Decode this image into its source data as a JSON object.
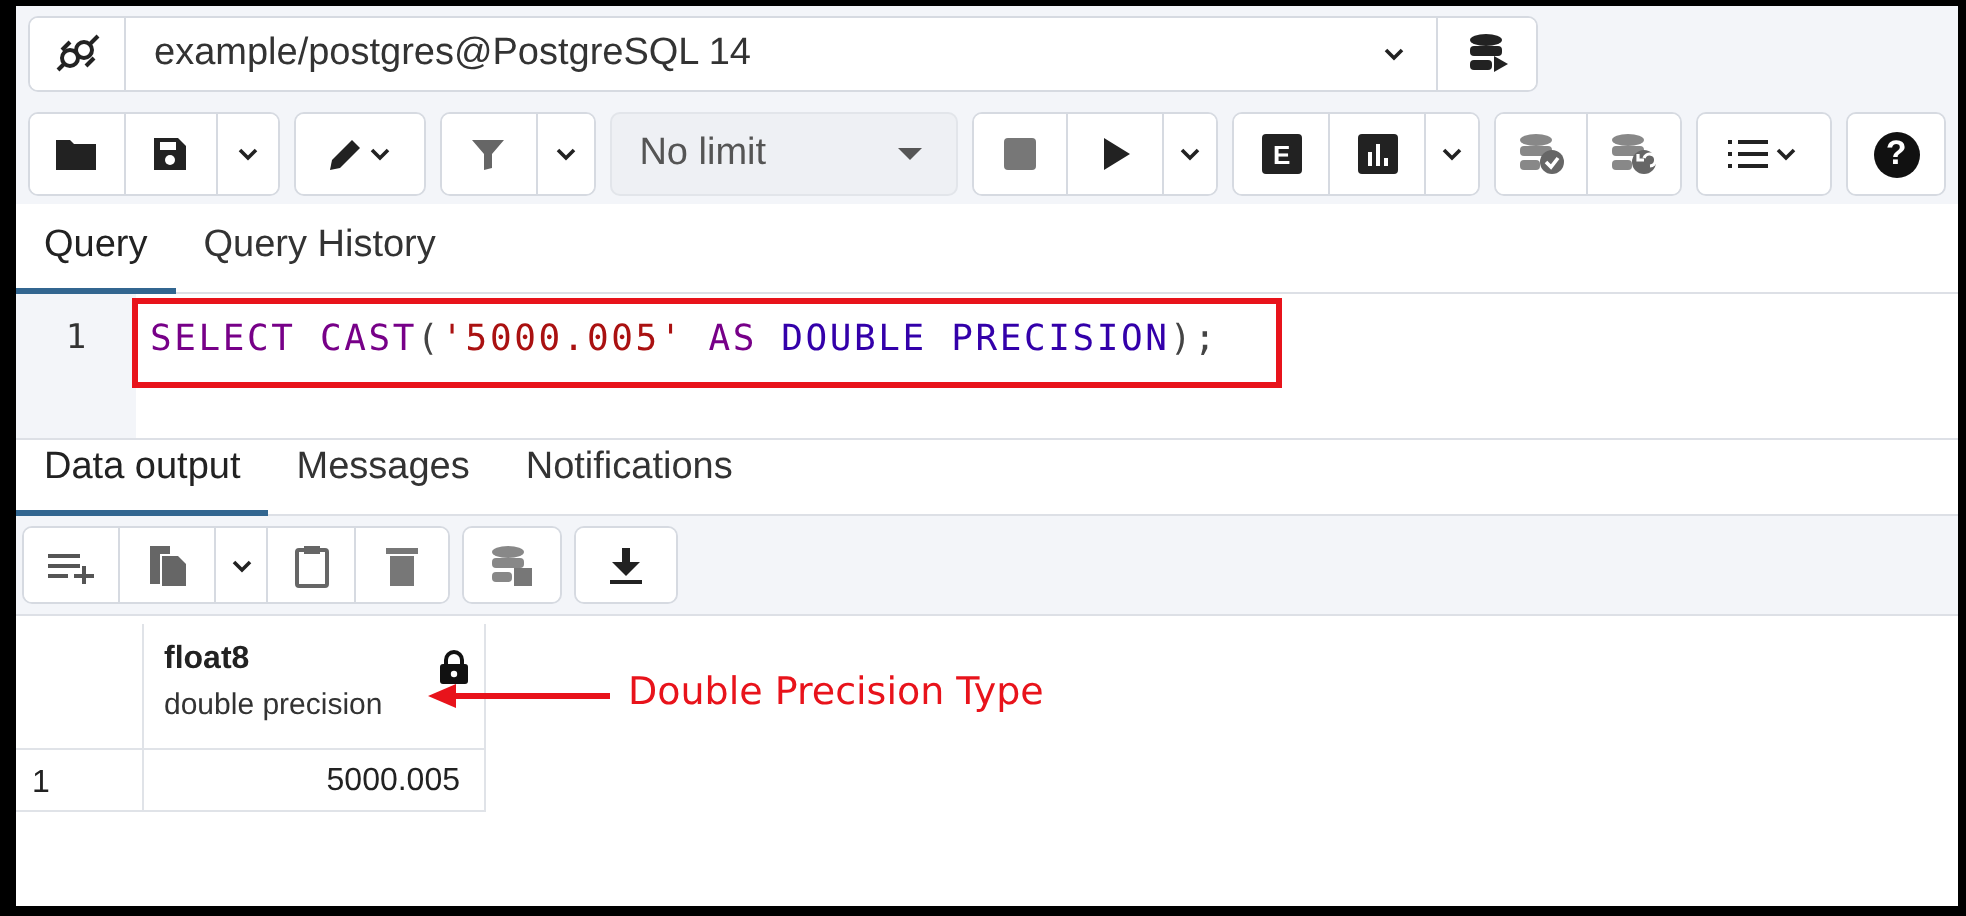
{
  "connection": {
    "value": "example/postgres@PostgreSQL 14"
  },
  "toolbar": {
    "row_limit": "No limit",
    "explain_label": "E",
    "help_label": "?"
  },
  "editor_tabs": [
    {
      "label": "Query",
      "selected": true
    },
    {
      "label": "Query History",
      "selected": false
    }
  ],
  "editor": {
    "lines": [
      {
        "number": "1",
        "highlighted": true,
        "tokens": [
          {
            "kind": "keyword",
            "text": "SELECT",
            "space_after": true
          },
          {
            "kind": "keyword",
            "text": "CAST",
            "space_after": false
          },
          {
            "kind": "punct",
            "text": "(",
            "space_after": false
          },
          {
            "kind": "string",
            "text": "'5000.005'",
            "space_after": true
          },
          {
            "kind": "keyword",
            "text": "AS",
            "space_after": true
          },
          {
            "kind": "type",
            "text": "DOUBLE PRECISION",
            "space_after": false
          },
          {
            "kind": "punct",
            "text": ");",
            "space_after": false
          }
        ]
      }
    ]
  },
  "output_tabs": [
    {
      "label": "Data output",
      "selected": true
    },
    {
      "label": "Messages",
      "selected": false
    },
    {
      "label": "Notifications",
      "selected": false
    }
  ],
  "grid": {
    "columns": [
      {
        "name": "float8",
        "type": "double precision",
        "locked": true
      }
    ],
    "rows": [
      {
        "number": "1",
        "cells": [
          "5000.005"
        ]
      }
    ]
  },
  "annotation": {
    "text": "Double Precision Type"
  }
}
